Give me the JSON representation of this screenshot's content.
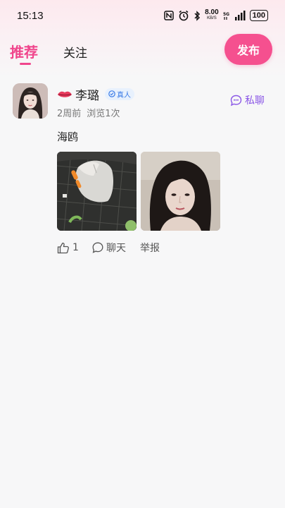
{
  "status_bar": {
    "time": "15:13",
    "net_speed_value": "8.00",
    "net_speed_unit": "KB/S",
    "battery": "100",
    "icons": [
      "nfc-icon",
      "alarm-icon",
      "bluetooth-icon",
      "5g-icon",
      "signal-icon",
      "battery-icon"
    ]
  },
  "nav": {
    "tabs": [
      {
        "label": "推荐",
        "active": true
      },
      {
        "label": "关注",
        "active": false
      }
    ],
    "publish_label": "发布"
  },
  "post": {
    "username": "李璐",
    "name_prefix_icon": "lips-icon",
    "verify_label": "真人",
    "time_ago": "2周前",
    "views": "浏览1次",
    "private_chat_label": "私聊",
    "text": "海鸥",
    "images": [
      "mouse-photo",
      "girl-portrait-photo"
    ],
    "actions": {
      "like_count": "1",
      "chat_label": "聊天",
      "report_label": "举报"
    }
  },
  "colors": {
    "accent": "#f0458c",
    "publish_bg": "#f5508f",
    "private_chat": "#8a56e6",
    "verify_text": "#3a7be6"
  }
}
